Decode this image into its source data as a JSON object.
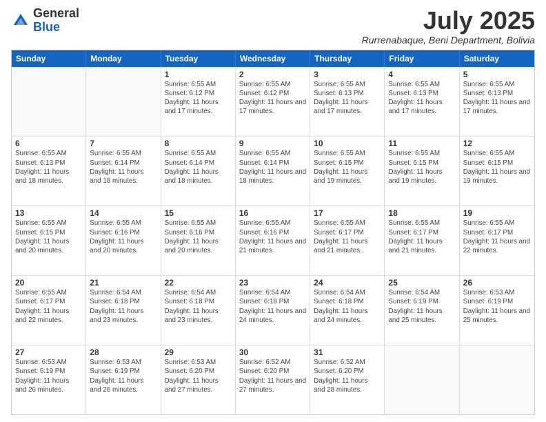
{
  "logo": {
    "general": "General",
    "blue": "Blue"
  },
  "title": "July 2025",
  "location": "Rurrenabaque, Beni Department, Bolivia",
  "days_of_week": [
    "Sunday",
    "Monday",
    "Tuesday",
    "Wednesday",
    "Thursday",
    "Friday",
    "Saturday"
  ],
  "weeks": [
    [
      {
        "day": "",
        "info": ""
      },
      {
        "day": "",
        "info": ""
      },
      {
        "day": "1",
        "info": "Sunrise: 6:55 AM\nSunset: 6:12 PM\nDaylight: 11 hours and 17 minutes."
      },
      {
        "day": "2",
        "info": "Sunrise: 6:55 AM\nSunset: 6:12 PM\nDaylight: 11 hours and 17 minutes."
      },
      {
        "day": "3",
        "info": "Sunrise: 6:55 AM\nSunset: 6:13 PM\nDaylight: 11 hours and 17 minutes."
      },
      {
        "day": "4",
        "info": "Sunrise: 6:55 AM\nSunset: 6:13 PM\nDaylight: 11 hours and 17 minutes."
      },
      {
        "day": "5",
        "info": "Sunrise: 6:55 AM\nSunset: 6:13 PM\nDaylight: 11 hours and 17 minutes."
      }
    ],
    [
      {
        "day": "6",
        "info": "Sunrise: 6:55 AM\nSunset: 6:13 PM\nDaylight: 11 hours and 18 minutes."
      },
      {
        "day": "7",
        "info": "Sunrise: 6:55 AM\nSunset: 6:14 PM\nDaylight: 11 hours and 18 minutes."
      },
      {
        "day": "8",
        "info": "Sunrise: 6:55 AM\nSunset: 6:14 PM\nDaylight: 11 hours and 18 minutes."
      },
      {
        "day": "9",
        "info": "Sunrise: 6:55 AM\nSunset: 6:14 PM\nDaylight: 11 hours and 18 minutes."
      },
      {
        "day": "10",
        "info": "Sunrise: 6:55 AM\nSunset: 6:15 PM\nDaylight: 11 hours and 19 minutes."
      },
      {
        "day": "11",
        "info": "Sunrise: 6:55 AM\nSunset: 6:15 PM\nDaylight: 11 hours and 19 minutes."
      },
      {
        "day": "12",
        "info": "Sunrise: 6:55 AM\nSunset: 6:15 PM\nDaylight: 11 hours and 19 minutes."
      }
    ],
    [
      {
        "day": "13",
        "info": "Sunrise: 6:55 AM\nSunset: 6:15 PM\nDaylight: 11 hours and 20 minutes."
      },
      {
        "day": "14",
        "info": "Sunrise: 6:55 AM\nSunset: 6:16 PM\nDaylight: 11 hours and 20 minutes."
      },
      {
        "day": "15",
        "info": "Sunrise: 6:55 AM\nSunset: 6:16 PM\nDaylight: 11 hours and 20 minutes."
      },
      {
        "day": "16",
        "info": "Sunrise: 6:55 AM\nSunset: 6:16 PM\nDaylight: 11 hours and 21 minutes."
      },
      {
        "day": "17",
        "info": "Sunrise: 6:55 AM\nSunset: 6:17 PM\nDaylight: 11 hours and 21 minutes."
      },
      {
        "day": "18",
        "info": "Sunrise: 6:55 AM\nSunset: 6:17 PM\nDaylight: 11 hours and 21 minutes."
      },
      {
        "day": "19",
        "info": "Sunrise: 6:55 AM\nSunset: 6:17 PM\nDaylight: 11 hours and 22 minutes."
      }
    ],
    [
      {
        "day": "20",
        "info": "Sunrise: 6:55 AM\nSunset: 6:17 PM\nDaylight: 11 hours and 22 minutes."
      },
      {
        "day": "21",
        "info": "Sunrise: 6:54 AM\nSunset: 6:18 PM\nDaylight: 11 hours and 23 minutes."
      },
      {
        "day": "22",
        "info": "Sunrise: 6:54 AM\nSunset: 6:18 PM\nDaylight: 11 hours and 23 minutes."
      },
      {
        "day": "23",
        "info": "Sunrise: 6:54 AM\nSunset: 6:18 PM\nDaylight: 11 hours and 24 minutes."
      },
      {
        "day": "24",
        "info": "Sunrise: 6:54 AM\nSunset: 6:18 PM\nDaylight: 11 hours and 24 minutes."
      },
      {
        "day": "25",
        "info": "Sunrise: 6:54 AM\nSunset: 6:19 PM\nDaylight: 11 hours and 25 minutes."
      },
      {
        "day": "26",
        "info": "Sunrise: 6:53 AM\nSunset: 6:19 PM\nDaylight: 11 hours and 25 minutes."
      }
    ],
    [
      {
        "day": "27",
        "info": "Sunrise: 6:53 AM\nSunset: 6:19 PM\nDaylight: 11 hours and 26 minutes."
      },
      {
        "day": "28",
        "info": "Sunrise: 6:53 AM\nSunset: 6:19 PM\nDaylight: 11 hours and 26 minutes."
      },
      {
        "day": "29",
        "info": "Sunrise: 6:53 AM\nSunset: 6:20 PM\nDaylight: 11 hours and 27 minutes."
      },
      {
        "day": "30",
        "info": "Sunrise: 6:52 AM\nSunset: 6:20 PM\nDaylight: 11 hours and 27 minutes."
      },
      {
        "day": "31",
        "info": "Sunrise: 6:52 AM\nSunset: 6:20 PM\nDaylight: 11 hours and 28 minutes."
      },
      {
        "day": "",
        "info": ""
      },
      {
        "day": "",
        "info": ""
      }
    ]
  ]
}
